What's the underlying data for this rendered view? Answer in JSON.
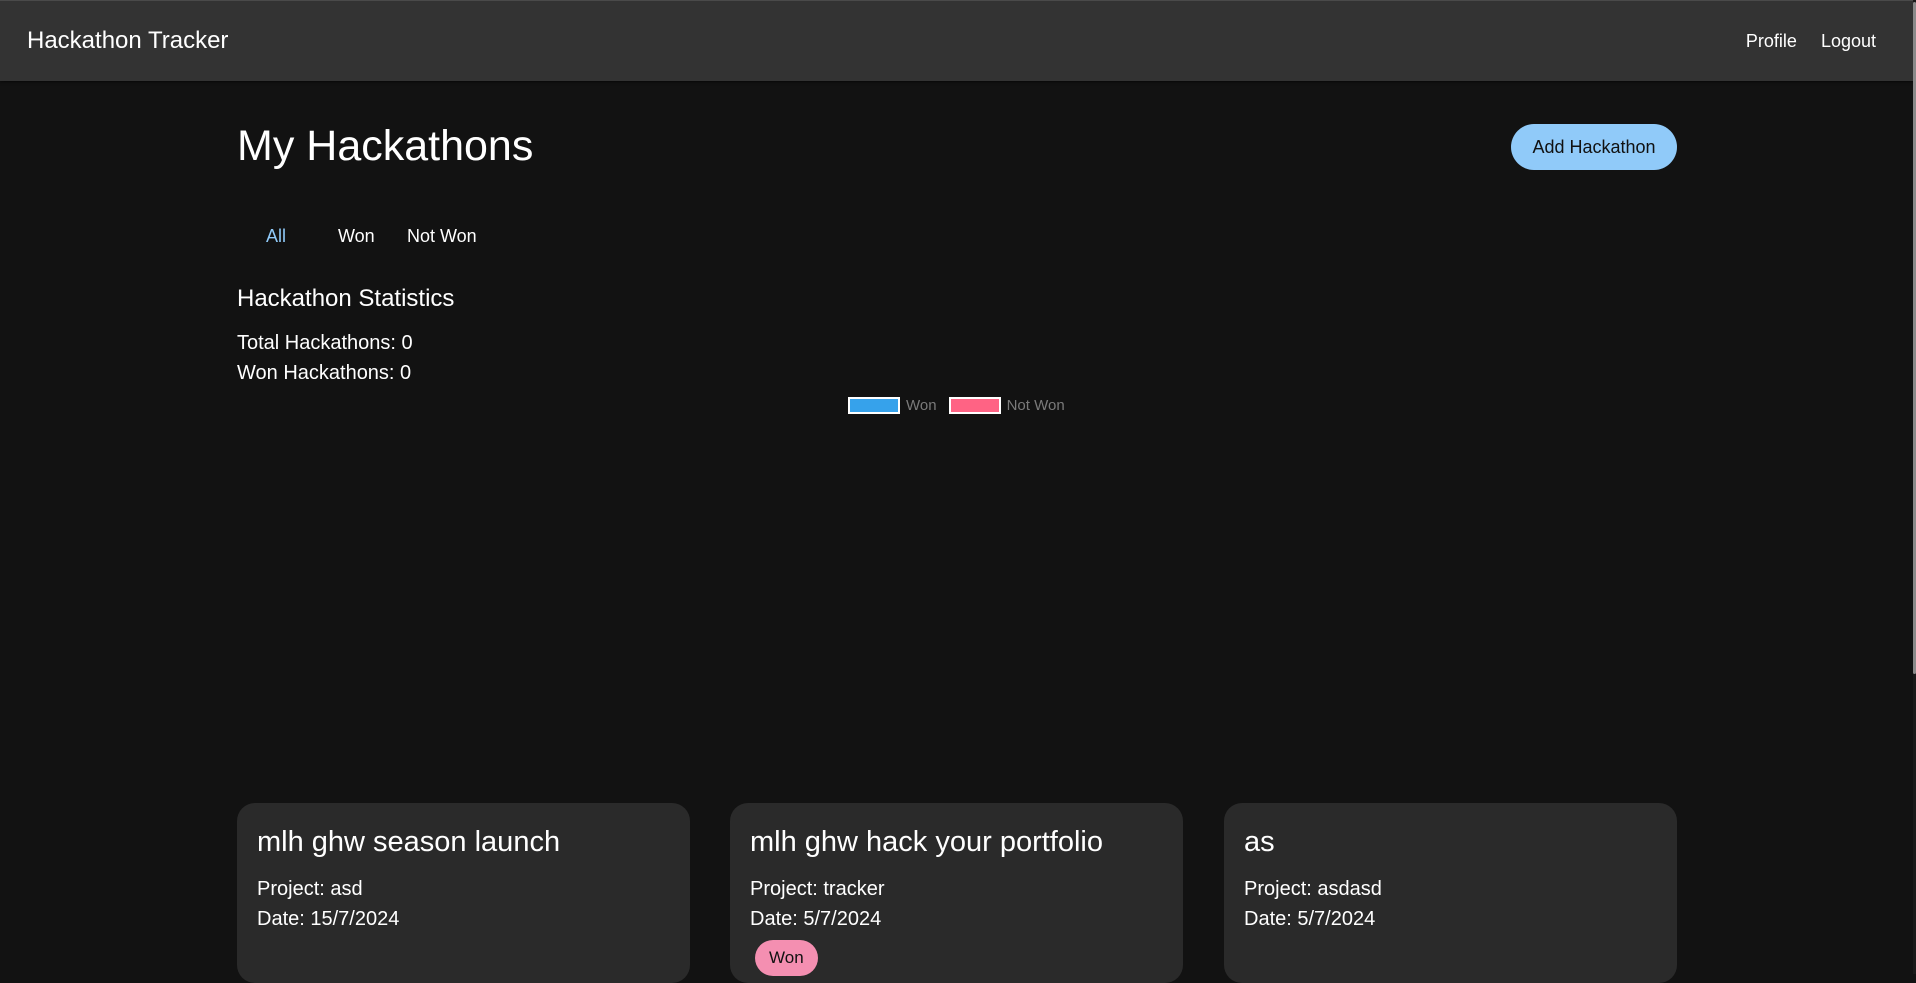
{
  "app": {
    "title": "Hackathon Tracker",
    "nav": {
      "profile_label": "Profile",
      "logout_label": "Logout"
    }
  },
  "header": {
    "page_title": "My Hackathons",
    "add_button_label": "Add Hackathon"
  },
  "tabs": [
    {
      "label": "All",
      "active": true
    },
    {
      "label": "Won",
      "active": false
    },
    {
      "label": "Not Won",
      "active": false
    }
  ],
  "stats": {
    "title": "Hackathon Statistics",
    "total_label": "Total Hackathons: 0",
    "won_label": "Won Hackathons: 0"
  },
  "chart_data": {
    "type": "pie",
    "categories": [
      "Won",
      "Not Won"
    ],
    "values": [
      0,
      0
    ],
    "legend": "top",
    "colors": [
      "#36a2eb",
      "#ff6384"
    ]
  },
  "hackathons": [
    {
      "name": "mlh ghw season launch",
      "project": "Project: asd",
      "date": "Date: 15/7/2024",
      "won": false
    },
    {
      "name": "mlh ghw hack your portfolio",
      "project": "Project: tracker",
      "date": "Date: 5/7/2024",
      "won": true,
      "badge": "Won"
    },
    {
      "name": "as",
      "project": "Project: asdasd",
      "date": "Date: 5/7/2024",
      "won": false
    }
  ],
  "colors": {
    "background": "#121212",
    "navbar": "#333333",
    "accent": "#90caf9",
    "card": "#2a2a2a",
    "won_badge": "#f48fb1"
  }
}
